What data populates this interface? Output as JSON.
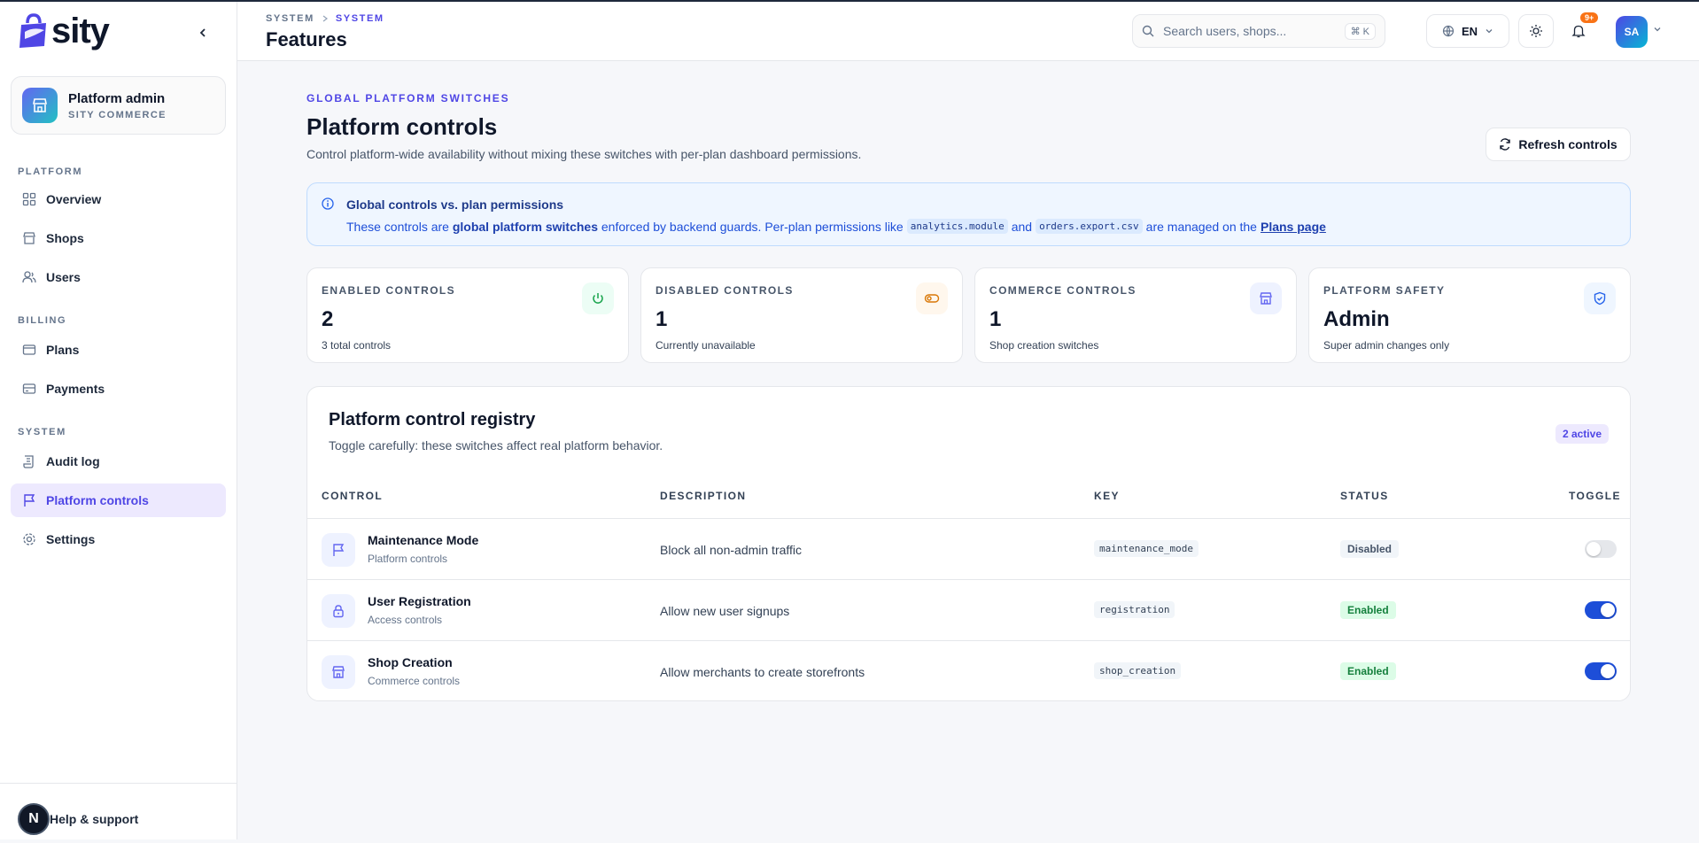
{
  "brand": {
    "name": "sity"
  },
  "org": {
    "name": "Platform admin",
    "sub": "SITY COMMERCE"
  },
  "sidebar": {
    "sections": [
      {
        "title": "PLATFORM"
      },
      {
        "title": "BILLING"
      },
      {
        "title": "SYSTEM"
      }
    ],
    "items": [
      {
        "label": "Overview",
        "icon": "grid-icon"
      },
      {
        "label": "Shops",
        "icon": "store-icon"
      },
      {
        "label": "Users",
        "icon": "users-icon"
      },
      {
        "label": "Plans",
        "icon": "wallet-icon"
      },
      {
        "label": "Payments",
        "icon": "credit-card-icon"
      },
      {
        "label": "Audit log",
        "icon": "scroll-icon"
      },
      {
        "label": "Platform controls",
        "icon": "flag-icon"
      },
      {
        "label": "Settings",
        "icon": "gear-icon"
      }
    ],
    "help": {
      "label": "Help & support",
      "badge": "N"
    }
  },
  "header": {
    "breadcrumb": [
      "SYSTEM",
      "SYSTEM"
    ],
    "title": "Features",
    "search_placeholder": "Search users, shops...",
    "search_shortcut": "⌘ K",
    "language": "EN",
    "notifications_badge": "9+",
    "avatar_initials": "SA"
  },
  "main": {
    "kicker": "GLOBAL PLATFORM SWITCHES",
    "title": "Platform controls",
    "subtitle": "Control platform-wide availability without mixing these switches with per-plan dashboard permissions.",
    "refresh_label": "Refresh controls",
    "info": {
      "title": "Global controls vs. plan permissions",
      "prefix": "These controls are",
      "bold": "global platform switches",
      "middle": "enforced by backend guards. Per-plan permissions like",
      "code1": "analytics.module",
      "and": "and",
      "code2": "orders.export.csv",
      "suffix": "are managed on the",
      "link": "Plans page"
    },
    "stats": [
      {
        "label": "ENABLED CONTROLS",
        "value": "2",
        "note": "3 total controls",
        "icon": "power-icon",
        "color": "#16a34a",
        "bg": "#ecfdf5"
      },
      {
        "label": "DISABLED CONTROLS",
        "value": "1",
        "note": "Currently unavailable",
        "icon": "toggle-icon",
        "color": "#d97706",
        "bg": "#fff7ed"
      },
      {
        "label": "COMMERCE CONTROLS",
        "value": "1",
        "note": "Shop creation switches",
        "icon": "store-icon",
        "color": "#6366f1",
        "bg": "#eef2ff"
      },
      {
        "label": "PLATFORM SAFETY",
        "value": "Admin",
        "note": "Super admin changes only",
        "icon": "shield-icon",
        "color": "#2563eb",
        "bg": "#eff6ff"
      }
    ],
    "registry": {
      "title": "Platform control registry",
      "subtitle": "Toggle carefully: these switches affect real platform behavior.",
      "badge": "2 active",
      "columns": [
        "CONTROL",
        "DESCRIPTION",
        "KEY",
        "STATUS",
        "TOGGLE"
      ],
      "rows": [
        {
          "name": "Maintenance Mode",
          "category": "Platform controls",
          "description": "Block all non-admin traffic",
          "key": "maintenance_mode",
          "status": "Disabled",
          "enabled": false,
          "icon": "flag-icon"
        },
        {
          "name": "User Registration",
          "category": "Access controls",
          "description": "Allow new user signups",
          "key": "registration",
          "status": "Enabled",
          "enabled": true,
          "icon": "lock-icon"
        },
        {
          "name": "Shop Creation",
          "category": "Commerce controls",
          "description": "Allow merchants to create storefronts",
          "key": "shop_creation",
          "status": "Enabled",
          "enabled": true,
          "icon": "store-icon"
        }
      ]
    }
  }
}
